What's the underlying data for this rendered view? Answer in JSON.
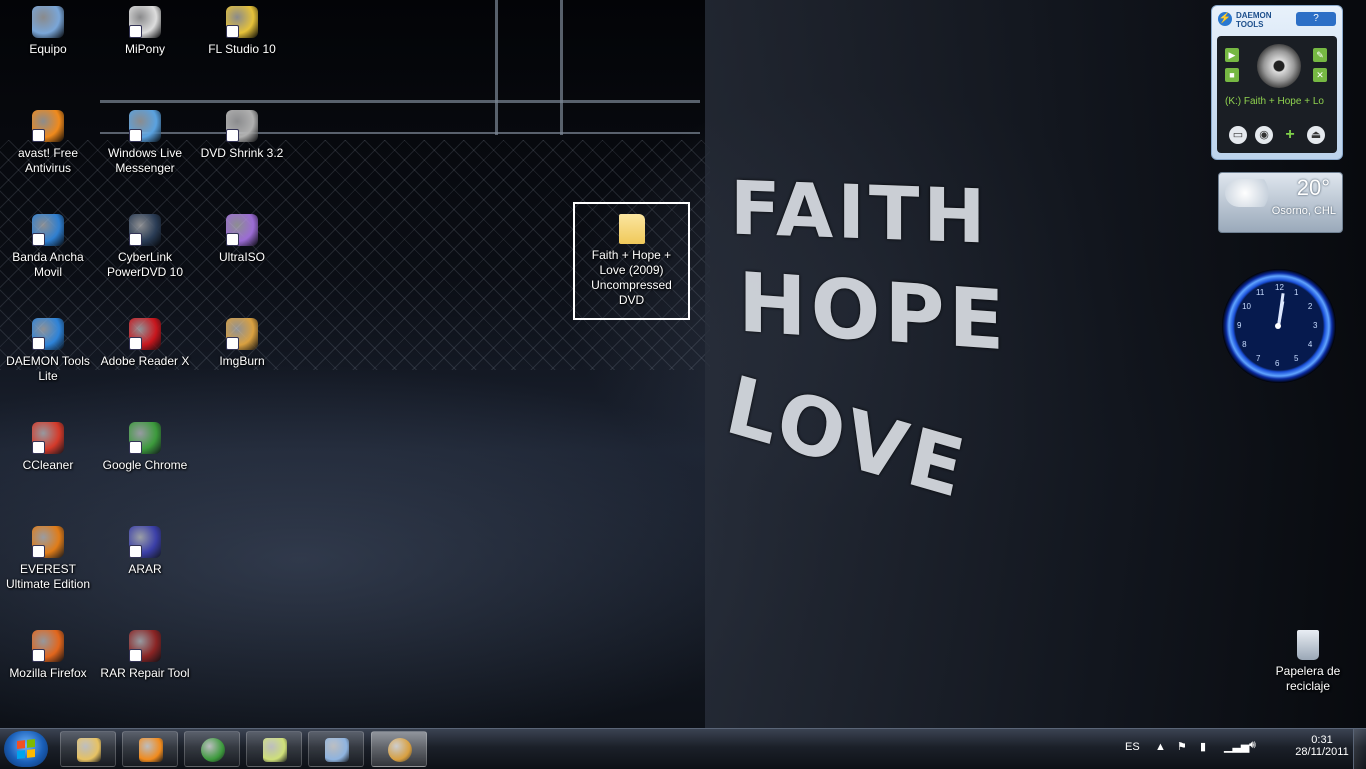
{
  "desktop": {
    "icons": [
      {
        "label": "Equipo",
        "color": "#7aa6d8",
        "arrow": false
      },
      {
        "label": "MiPony",
        "color": "#dddddd",
        "arrow": true
      },
      {
        "label": "FL Studio 10",
        "color": "#e6c23a",
        "arrow": true
      },
      {
        "label": "avast! Free Antivirus",
        "color": "#f08a1c",
        "arrow": true
      },
      {
        "label": "Windows Live Messenger",
        "color": "#5aa2e0",
        "arrow": true
      },
      {
        "label": "DVD Shrink 3.2",
        "color": "#b0b0b0",
        "arrow": true
      },
      {
        "label": "Banda Ancha Movil",
        "color": "#2f7fd0",
        "arrow": true
      },
      {
        "label": "CyberLink PowerDVD 10",
        "color": "#2a3c55",
        "arrow": true
      },
      {
        "label": "UltraISO",
        "color": "#9b6cd4",
        "arrow": true
      },
      {
        "label": "DAEMON Tools Lite",
        "color": "#2e83d8",
        "arrow": true
      },
      {
        "label": "Adobe Reader X",
        "color": "#c8161d",
        "arrow": true
      },
      {
        "label": "ImgBurn",
        "color": "#d9a040",
        "arrow": true
      },
      {
        "label": "CCleaner",
        "color": "#d43a2a",
        "arrow": true
      },
      {
        "label": "Google Chrome",
        "color": "#3c9a3c",
        "arrow": true
      },
      {
        "label": "EVEREST Ultimate Edition",
        "color": "#e07c18",
        "arrow": true
      },
      {
        "label": "ARAR",
        "color": "#3b3fa8",
        "arrow": true
      },
      {
        "label": "Mozilla Firefox",
        "color": "#e2661c",
        "arrow": true
      },
      {
        "label": "RAR Repair Tool",
        "color": "#8a2424",
        "arrow": true
      }
    ],
    "selected_folder": {
      "label": "Faith + Hope + Love (2009) Uncompressed DVD",
      "color": "#f0c95a"
    },
    "recycle_bin": {
      "label": "Papelera de reciclaje"
    }
  },
  "wallpaper": {
    "line1": "FAITH",
    "line2": "HOPE",
    "line3": "LOVE"
  },
  "gadgets": {
    "daemon": {
      "title": "DAEMON TOOLS",
      "help_label": "?",
      "drive_label": "(K:) Faith + Hope + Lo"
    },
    "weather": {
      "temperature": "20°",
      "location": "Osorno, CHL"
    },
    "clock": {
      "numbers": [
        "12",
        "1",
        "2",
        "3",
        "4",
        "5",
        "6",
        "7",
        "8",
        "9",
        "10",
        "11"
      ]
    }
  },
  "taskbar": {
    "pinned": [
      {
        "name": "explorer",
        "color": "#e7c263"
      },
      {
        "name": "media-player",
        "color": "#f18b1d"
      },
      {
        "name": "chrome",
        "color": "#3c9a3c"
      },
      {
        "name": "sticky-notes",
        "color": "#cfe07a"
      },
      {
        "name": "paint",
        "color": "#8fb4e0"
      },
      {
        "name": "imgburn",
        "color": "#d9a040"
      }
    ],
    "tray": {
      "language": "ES",
      "time": "0:31",
      "date": "28/11/2011"
    }
  }
}
